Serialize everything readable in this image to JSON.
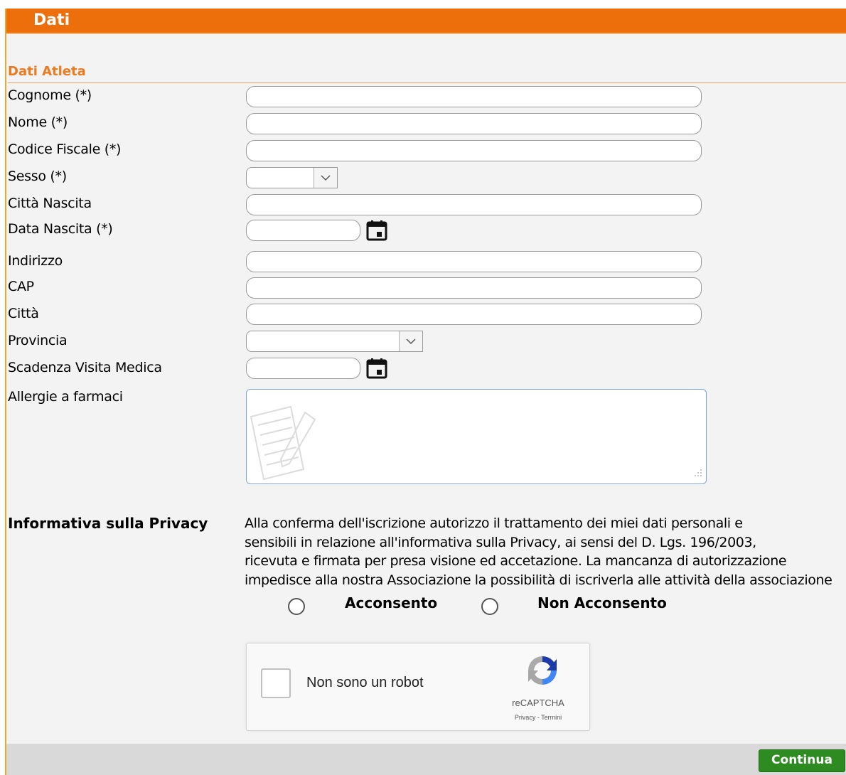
{
  "header": {
    "title": "Dati"
  },
  "section": {
    "title": "Dati Atleta"
  },
  "fields": {
    "cognome": {
      "label": "Cognome (*)",
      "value": ""
    },
    "nome": {
      "label": "Nome (*)",
      "value": ""
    },
    "codice_fiscale": {
      "label": "Codice Fiscale (*)",
      "value": ""
    },
    "sesso": {
      "label": "Sesso (*)",
      "selected": ""
    },
    "citta_nascita": {
      "label": "Città Nascita",
      "value": ""
    },
    "data_nascita": {
      "label": "Data Nascita (*)",
      "value": "",
      "icon": "calendar-icon"
    },
    "indirizzo": {
      "label": "Indirizzo",
      "value": ""
    },
    "cap": {
      "label": "CAP",
      "value": ""
    },
    "citta": {
      "label": "Città",
      "value": ""
    },
    "provincia": {
      "label": "Provincia",
      "selected": ""
    },
    "scadenza_visita": {
      "label": "Scadenza Visita Medica",
      "value": "",
      "icon": "calendar-icon"
    },
    "allergie": {
      "label": "Allergie a farmaci",
      "value": ""
    }
  },
  "privacy": {
    "label": "Informativa sulla Privacy",
    "lines": [
      "Alla conferma dell'iscrizione autorizzo il trattamento dei miei dati personali e",
      "sensibili in relazione all'informativa sulla Privacy, ai sensi del D. Lgs. 196/2003,",
      "ricevuta e firmata per presa visione ed accetazione. La mancanza di autorizzazione",
      "impedisce alla nostra Associazione la possibilità di iscriverla alle attività della associazione"
    ],
    "options": {
      "accept": "Acconsento",
      "decline": "Non Acconsento"
    }
  },
  "captcha": {
    "label": "Non sono un robot",
    "brand": "reCAPTCHA",
    "links": "Privacy - Termini"
  },
  "footer": {
    "continue_label": "Continua"
  },
  "colors": {
    "header": "#ec6f0c",
    "section_title": "#ec7a1f",
    "panel_border": "#f0a830",
    "continue_button": "#2e8b22"
  }
}
